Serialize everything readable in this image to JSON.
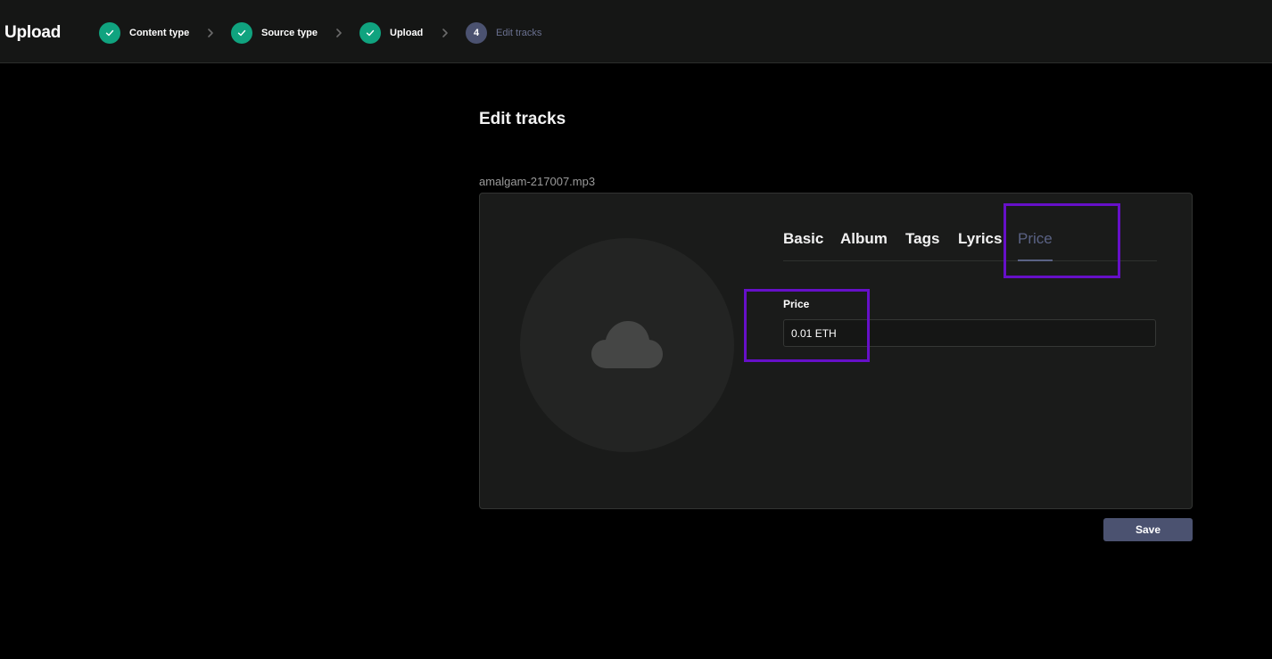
{
  "header": {
    "title": "Upload",
    "steps": [
      {
        "label": "Content type",
        "status": "done"
      },
      {
        "label": "Source type",
        "status": "done"
      },
      {
        "label": "Upload",
        "status": "done"
      },
      {
        "label": "Edit tracks",
        "number": "4",
        "status": "current"
      }
    ]
  },
  "main": {
    "title": "Edit tracks",
    "file_name": "amalgam-217007.mp3",
    "artwork_icon": "cloud-icon",
    "tabs": [
      {
        "label": "Basic"
      },
      {
        "label": "Album"
      },
      {
        "label": "Tags"
      },
      {
        "label": "Lyrics"
      },
      {
        "label": "Price",
        "active": true
      }
    ],
    "price_field": {
      "label": "Price",
      "value": "0.01 ETH",
      "placeholder": ""
    },
    "save_label": "Save"
  },
  "colors": {
    "accent_done": "#10a37f",
    "accent_pending": "#4b5270",
    "highlight": "#6610c8"
  }
}
